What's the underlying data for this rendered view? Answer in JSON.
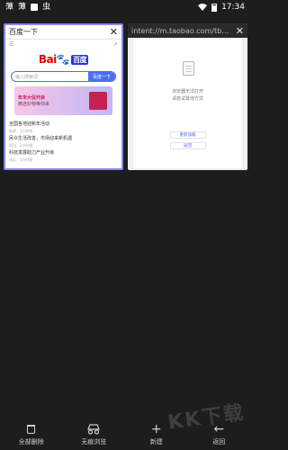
{
  "status_bar": {
    "left_glyphs": [
      "藫",
      "藫",
      "虫"
    ],
    "time": "17:34"
  },
  "tabs": [
    {
      "title": "百度一下",
      "page": {
        "logo_text_left": "Bai",
        "logo_text_right": "百度",
        "search_placeholder": "输入搜索词",
        "search_button": "百度一下",
        "banner_title": "年末大促开启",
        "banner_subtitle": "精选好物等你来",
        "news": [
          {
            "title": "全国各地迎新年活动",
            "meta": "新闻 · 1小时前"
          },
          {
            "title": "民众生活改善，市场迎来新机遇",
            "meta": "资讯 · 2小时前"
          },
          {
            "title": "科技发展助力产业升级",
            "meta": "热点 · 3小时前"
          }
        ]
      }
    },
    {
      "title": "intent://m.taobao.com/tbopen/i...",
      "page": {
        "message_line1": "浏览器无法打开",
        "message_line2": "请尝试其他方式",
        "button1": "重新加载",
        "button2": "返回"
      }
    }
  ],
  "toolbar": {
    "delete_all": "全部删除",
    "incognito": "无痕浏览",
    "new_tab": "新建",
    "back": "返回"
  },
  "watermark": "KK下载",
  "colors": {
    "background": "#1d1d1d",
    "active_tab_border": "#8989e9",
    "baidu_blue": "#4e6ef2",
    "baidu_red": "#e10601"
  }
}
